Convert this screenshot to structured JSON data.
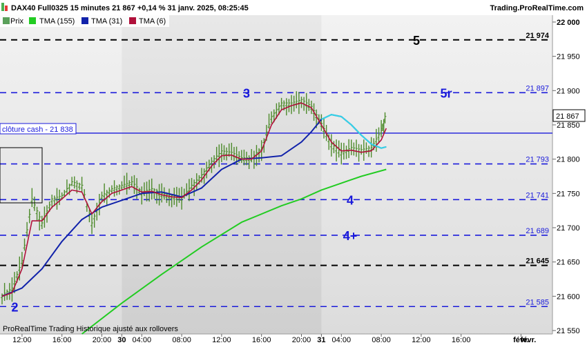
{
  "header": {
    "title": "DAX40 Full0325 15 minutes 21 867 +0,14 % 31 janv. 2025, 08:25:45",
    "brand": "Trading.ProRealTime.com"
  },
  "legend": [
    {
      "label": "Prix",
      "color": "#5aa05a"
    },
    {
      "label": "TMA (155)",
      "color": "#22cc22"
    },
    {
      "label": "TMA (31)",
      "color": "#1122aa"
    },
    {
      "label": "TMA (6)",
      "color": "#b0103a"
    }
  ],
  "footer_note": "ProRealTime Trading  Historique ajusté aux rollovers",
  "cloture_label": "clôture cash -  21 838",
  "current_price_label": "21 867",
  "levels": [
    {
      "value": 21974,
      "label": "21 974",
      "style": "black-dashed",
      "tag": "5",
      "tag_color": "#000000"
    },
    {
      "value": 21897,
      "label": "21 897",
      "style": "blue-dashed",
      "tag": "5r",
      "tag_color": "#1a1adb"
    },
    {
      "value": 21838,
      "label": "",
      "style": "blue-solid",
      "tag": "",
      "tag_color": ""
    },
    {
      "value": 21793,
      "label": "21 793",
      "style": "blue-dashed",
      "tag": "",
      "tag_color": ""
    },
    {
      "value": 21741,
      "label": "21 741",
      "style": "blue-dashed",
      "tag": "4",
      "tag_color": "#1a1adb"
    },
    {
      "value": 21689,
      "label": "21 689",
      "style": "blue-dashed",
      "tag": "4+",
      "tag_color": "#1a1adb"
    },
    {
      "value": 21645,
      "label": "21 645",
      "style": "black-dashed",
      "tag": "",
      "tag_color": ""
    },
    {
      "value": 21585,
      "label": "21 585",
      "style": "blue-dashed",
      "tag": "",
      "tag_color": ""
    }
  ],
  "chart_labels": [
    {
      "text": "3",
      "x": 24.5,
      "y": 21897,
      "color": "#1a1adb"
    },
    {
      "text": "2",
      "x": 1.0,
      "y": 21585,
      "color": "#1a1adb"
    }
  ],
  "chart_data": {
    "type": "line",
    "title": "DAX40 Full0325 15 minutes",
    "ylim": [
      21545,
      22010
    ],
    "xlim": [
      0,
      42.5
    ],
    "x_unit": "hours since 29 janv. 2025 10:00",
    "y_ticks": [
      {
        "value": 22000,
        "label": "22 000",
        "bold": true
      },
      {
        "value": 21950,
        "label": "21 950",
        "bold": false
      },
      {
        "value": 21900,
        "label": "21 900",
        "bold": false
      },
      {
        "value": 21850,
        "label": "21 850",
        "bold": false
      },
      {
        "value": 21800,
        "label": "21 800",
        "bold": false
      },
      {
        "value": 21750,
        "label": "21 750",
        "bold": false
      },
      {
        "value": 21700,
        "label": "21 700",
        "bold": false
      },
      {
        "value": 21650,
        "label": "21 650",
        "bold": false
      },
      {
        "value": 21600,
        "label": "21 600",
        "bold": false
      },
      {
        "value": 21550,
        "label": "21 550",
        "bold": false
      }
    ],
    "x_ticks": [
      {
        "x": 2,
        "label": "12:00",
        "bold": false
      },
      {
        "x": 6,
        "label": "16:00",
        "bold": false
      },
      {
        "x": 10,
        "label": "20:00",
        "bold": false
      },
      {
        "x": 12,
        "label": "30",
        "bold": true
      },
      {
        "x": 14,
        "label": "04:00",
        "bold": false
      },
      {
        "x": 18,
        "label": "08:00",
        "bold": false
      },
      {
        "x": 22,
        "label": "12:00",
        "bold": false
      },
      {
        "x": 26,
        "label": "16:00",
        "bold": false
      },
      {
        "x": 30,
        "label": "20:00",
        "bold": false
      },
      {
        "x": 32,
        "label": "31",
        "bold": true
      },
      {
        "x": 34,
        "label": "04:00",
        "bold": false
      },
      {
        "x": 38,
        "label": "08:00",
        "bold": false
      },
      {
        "x": 42,
        "label": "12:00",
        "bold": false
      },
      {
        "x": 46,
        "label": "16:00",
        "bold": false
      },
      {
        "x": 52,
        "label": "févr.",
        "bold": true
      }
    ],
    "session_shading": [
      {
        "x0": 12,
        "x1": 32,
        "label": "30"
      }
    ],
    "series": [
      {
        "name": "Prix",
        "kind": "ohlc",
        "color": "#4c8a2a",
        "x": [
          0,
          1,
          2,
          3,
          4,
          5,
          6,
          7,
          8,
          9,
          10,
          11,
          12,
          13,
          14,
          15,
          16,
          17,
          18,
          19,
          20,
          21,
          22,
          23,
          24,
          25,
          26,
          27,
          28,
          29,
          30,
          31,
          32,
          33,
          34,
          35,
          36,
          37,
          38,
          38.5
        ],
        "values": [
          21600,
          21610,
          21650,
          21740,
          21705,
          21740,
          21745,
          21765,
          21760,
          21705,
          21745,
          21755,
          21760,
          21765,
          21750,
          21755,
          21748,
          21745,
          21742,
          21760,
          21775,
          21795,
          21810,
          21808,
          21800,
          21800,
          21815,
          21860,
          21880,
          21880,
          21885,
          21875,
          21850,
          21820,
          21808,
          21815,
          21812,
          21815,
          21840,
          21867
        ]
      },
      {
        "name": "TMA (155)",
        "kind": "line",
        "color": "#22cc22",
        "x": [
          8,
          12,
          16,
          20,
          24,
          28,
          30,
          32,
          34,
          36,
          38.5
        ],
        "values": [
          21545,
          21590,
          21632,
          21672,
          21708,
          21732,
          21742,
          21755,
          21765,
          21775,
          21785
        ]
      },
      {
        "name": "TMA (31)",
        "kind": "line",
        "color": "#1122aa",
        "x": [
          0,
          2,
          4,
          6,
          8,
          10,
          12,
          14,
          16,
          18,
          20,
          22,
          24,
          26,
          28,
          30,
          31,
          32,
          33,
          34,
          35,
          36,
          37,
          38,
          38.5
        ],
        "values": [
          21600,
          21612,
          21640,
          21680,
          21712,
          21730,
          21740,
          21750,
          21752,
          21745,
          21758,
          21785,
          21800,
          21802,
          21805,
          21825,
          21840,
          21858,
          21865,
          21862,
          21850,
          21835,
          21822,
          21816,
          21818
        ]
      },
      {
        "name": "TMA (6)",
        "kind": "line",
        "color": "#b0103a",
        "x": [
          0,
          1,
          2,
          3,
          4,
          5,
          6,
          7,
          8,
          9,
          10,
          11,
          12,
          13,
          14,
          15,
          16,
          17,
          18,
          19,
          20,
          21,
          22,
          23,
          24,
          25,
          26,
          27,
          28,
          29,
          30,
          31,
          32,
          33,
          34,
          35,
          36,
          37,
          38,
          38.5
        ],
        "values": [
          21600,
          21605,
          21640,
          21710,
          21710,
          21730,
          21742,
          21755,
          21752,
          21720,
          21738,
          21750,
          21755,
          21760,
          21752,
          21753,
          21748,
          21745,
          21744,
          21755,
          21770,
          21790,
          21805,
          21806,
          21800,
          21800,
          21812,
          21850,
          21872,
          21878,
          21882,
          21875,
          21850,
          21825,
          21812,
          21813,
          21810,
          21812,
          21828,
          21845
        ]
      }
    ]
  }
}
